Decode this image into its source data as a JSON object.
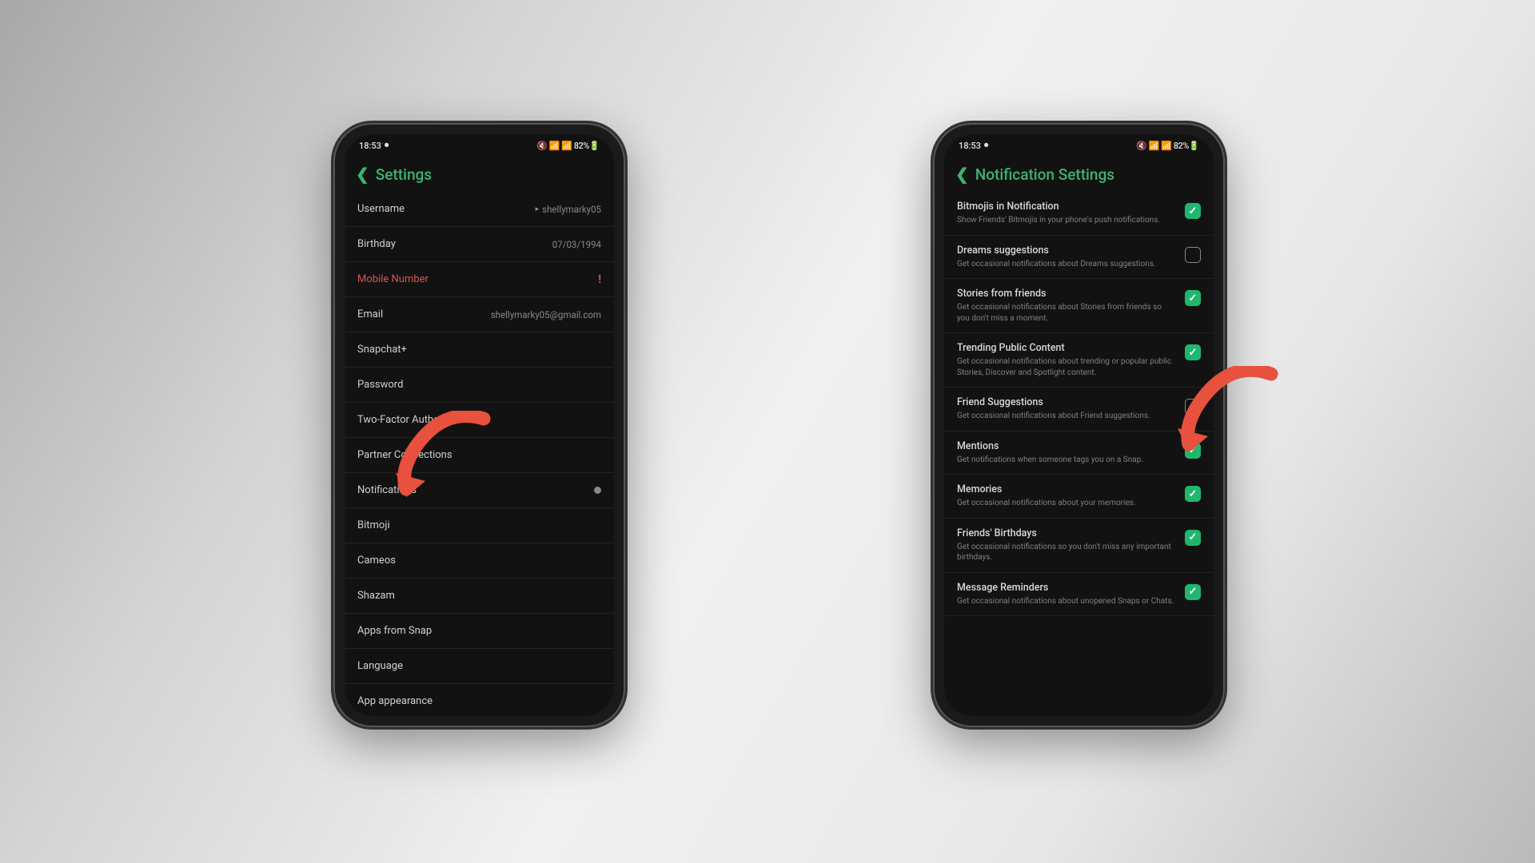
{
  "status": {
    "time": "18:53",
    "recording": "⏺",
    "icons_right": "🔇 📶 📶 82%🔋"
  },
  "phone1": {
    "header": "Settings",
    "rows": [
      {
        "label": "Username",
        "value": "shellymarky05",
        "caret": true
      },
      {
        "label": "Birthday",
        "value": "07/03/1994"
      },
      {
        "label": "Mobile Number",
        "value": "!",
        "warn": true
      },
      {
        "label": "Email",
        "value": "shellymarky05@gmail.com"
      },
      {
        "label": "Snapchat+"
      },
      {
        "label": "Password"
      },
      {
        "label": "Two-Factor Authentication"
      },
      {
        "label": "Partner Connections"
      },
      {
        "label": "Notifications",
        "dot": true
      },
      {
        "label": "Bitmoji"
      },
      {
        "label": "Cameos"
      },
      {
        "label": "Shazam"
      },
      {
        "label": "Apps from Snap"
      },
      {
        "label": "Language"
      },
      {
        "label": "App appearance"
      }
    ]
  },
  "phone2": {
    "header": "Notification Settings",
    "rows": [
      {
        "title": "Bitmojis in Notification",
        "desc": "Show Friends' Bitmojis in your phone's push notifications.",
        "checked": true
      },
      {
        "title": "Dreams suggestions",
        "desc": "Get occasional notifications about Dreams suggestions.",
        "checked": false
      },
      {
        "title": "Stories from friends",
        "desc": "Get occasional notifications about Stories from friends so you don't miss a moment.",
        "checked": true
      },
      {
        "title": "Trending Public Content",
        "desc": "Get occasional notifications about trending or popular public Stories, Discover and Spotlight content.",
        "checked": true
      },
      {
        "title": "Friend Suggestions",
        "desc": "Get occasional notifications about Friend suggestions.",
        "checked": false
      },
      {
        "title": "Mentions",
        "desc": "Get notifications when someone tags you on a Snap.",
        "checked": true
      },
      {
        "title": "Memories",
        "desc": "Get occasional notifications about your memories.",
        "checked": true
      },
      {
        "title": "Friends' Birthdays",
        "desc": "Get occasional notifications so you don't miss any important birthdays.",
        "checked": true
      },
      {
        "title": "Message Reminders",
        "desc": "Get occasional notifications about unopened Snaps or Chats.",
        "checked": true
      }
    ]
  }
}
